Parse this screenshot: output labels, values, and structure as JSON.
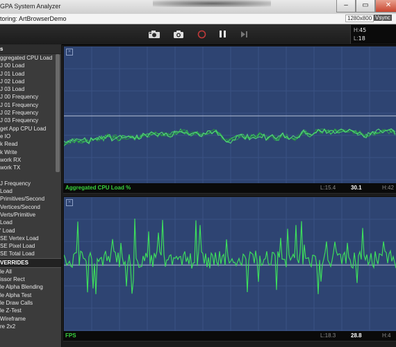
{
  "window": {
    "title": "GPA System Analyzer",
    "minimize_glyph": "–",
    "maximize_glyph": "▭",
    "close_glyph": "✕"
  },
  "status": {
    "monitoring": "toring: ArtBrowserDemo",
    "resolution": "1280x800",
    "vsync": "Vsync"
  },
  "toolbar": {
    "icons": [
      "camera-record-icon",
      "camera-icon",
      "record-icon",
      "pause-icon",
      "step-forward-icon"
    ]
  },
  "readout": {
    "h_label": "H:",
    "h_value": "45",
    "l_label": "L:",
    "l_value": "18"
  },
  "metrics": {
    "header": "s",
    "items": [
      "ggregated CPU Load",
      "J 00 Load",
      "J 01 Load",
      "J 02 Load",
      "J 03 Load",
      "J 00 Frequency",
      "J 01 Frequency",
      "J 02 Frequency",
      "J 03 Frequency",
      "get App CPU Load",
      "e IO",
      "k Read",
      "k Write",
      "work RX",
      "work TX",
      "",
      "J Frequency",
      "Load",
      "Primitives/Second",
      "Vertices/Second",
      "Verts/Primitive",
      "Load",
      "' Load",
      "SE Vertex Load",
      "SE Pixel Load",
      "SE Total Load"
    ]
  },
  "overrides": {
    "header": "VERRIDES",
    "items": [
      "le All",
      "issor Rect",
      "le Alpha Blending",
      "le Alpha Test",
      "le Draw Calls",
      "le Z-Test",
      " Wireframe",
      "re 2x2"
    ]
  },
  "graphs": [
    {
      "label": "Aggregated CPU Load %",
      "low": "L:15.4",
      "current": "30.1",
      "high": "H:42",
      "close_glyph": "×"
    },
    {
      "label": "FPS",
      "low": "L:18.3",
      "current": "28.8",
      "high": "H:4",
      "close_glyph": "×"
    }
  ],
  "colors": {
    "graph_bg": "#2e4472",
    "line": "#3ddc5c",
    "label_green": "#39d33e"
  }
}
